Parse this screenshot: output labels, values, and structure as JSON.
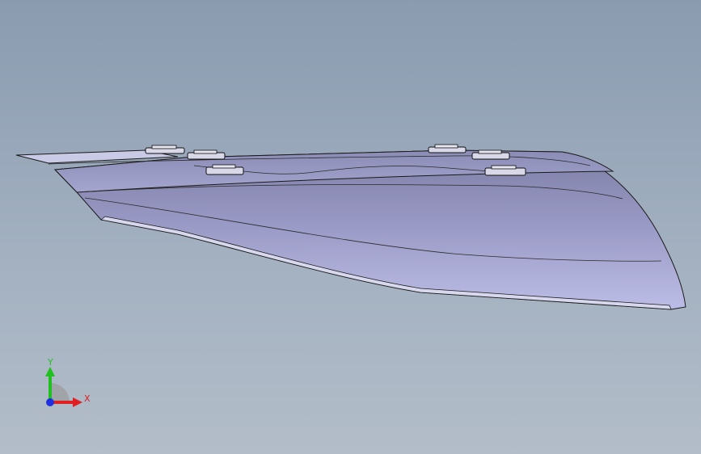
{
  "viewport": {
    "background_top": "#8a9bb0",
    "background_bottom": "#b3bdc9"
  },
  "model": {
    "surface_color_light": "#bcbde6",
    "surface_color_dark": "#7e7fa6",
    "edge_color": "#1a1a1a",
    "mount_icon": "clip-mount-icon"
  },
  "triad": {
    "x_label": "X",
    "y_label": "Y",
    "x_color": "#e02020",
    "y_color": "#20c020",
    "z_color": "#2030e0"
  }
}
